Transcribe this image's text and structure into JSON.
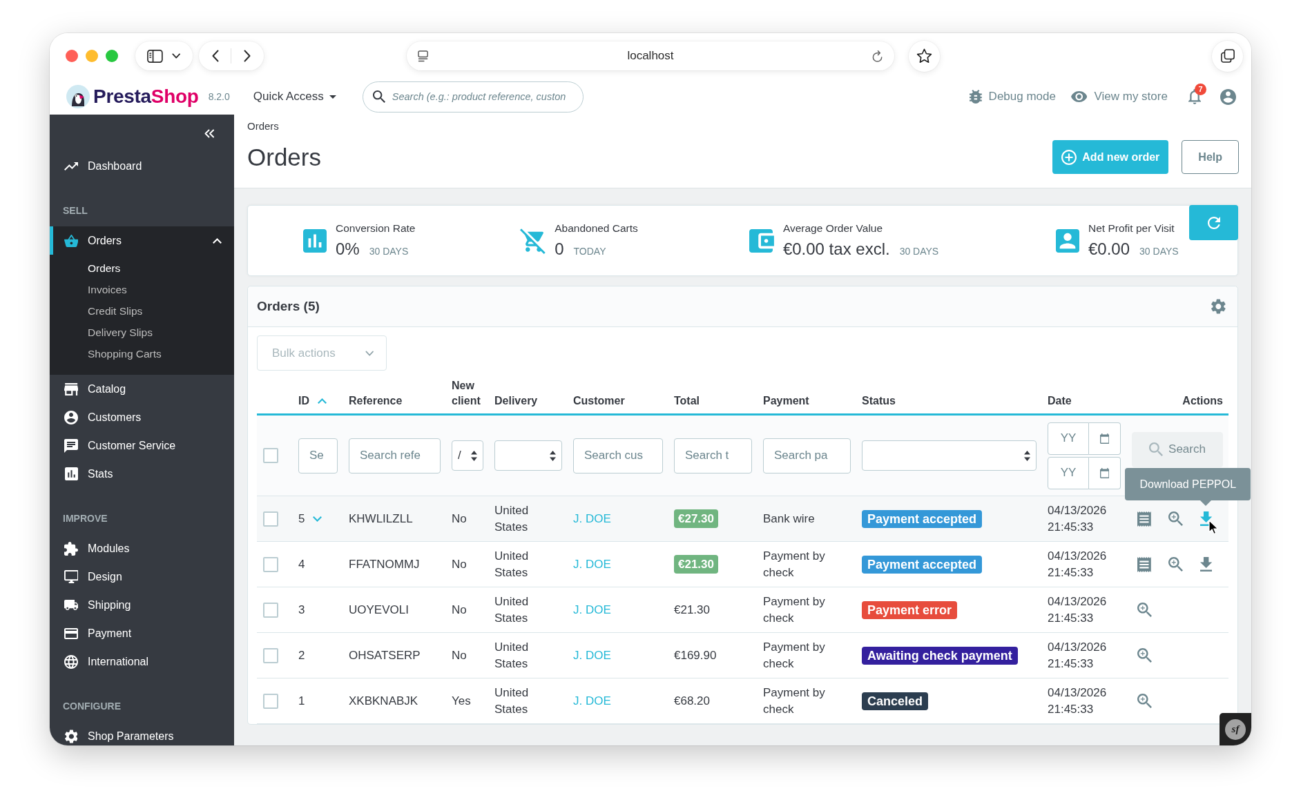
{
  "browser": {
    "url": "localhost"
  },
  "header": {
    "logo": [
      "Presta",
      "Shop"
    ],
    "version": "8.2.0",
    "quick_access": "Quick Access",
    "search": {
      "placeholder": "Search (e.g.: product reference, custon"
    },
    "debug_mode": "Debug mode",
    "view_store": "View my store",
    "notifications": "7"
  },
  "sidebar": {
    "sections": [
      {
        "items": [
          {
            "label": "Dashboard",
            "selected": false
          }
        ]
      },
      {
        "title": "SELL",
        "items": [
          {
            "label": "Orders",
            "selected": true,
            "expanded": true,
            "children": [
              {
                "label": "Orders",
                "selected": true
              },
              {
                "label": "Invoices",
                "selected": false
              },
              {
                "label": "Credit Slips",
                "selected": false
              },
              {
                "label": "Delivery Slips",
                "selected": false
              },
              {
                "label": "Shopping Carts",
                "selected": false
              }
            ]
          },
          {
            "label": "Catalog",
            "selected": false
          },
          {
            "label": "Customers",
            "selected": false
          },
          {
            "label": "Customer Service",
            "selected": false
          },
          {
            "label": "Stats",
            "selected": false
          }
        ]
      },
      {
        "title": "IMPROVE",
        "items": [
          {
            "label": "Modules",
            "selected": false
          },
          {
            "label": "Design",
            "selected": false
          },
          {
            "label": "Shipping",
            "selected": false
          },
          {
            "label": "Payment",
            "selected": false
          },
          {
            "label": "International",
            "selected": false
          }
        ]
      },
      {
        "title": "CONFIGURE",
        "items": [
          {
            "label": "Shop Parameters",
            "selected": false
          }
        ]
      }
    ]
  },
  "page": {
    "breadcrumb": "Orders",
    "title": "Orders",
    "buttons": [
      {
        "kind": "primary",
        "label": "Add new order"
      },
      {
        "kind": "outline",
        "label": "Help"
      }
    ]
  },
  "kpis": [
    {
      "label": "Conversion Rate",
      "value": "0%",
      "period": "30 DAYS"
    },
    {
      "label": "Abandoned Carts",
      "value": "0",
      "period": "TODAY"
    },
    {
      "label": "Average Order Value",
      "value": "€0.00 tax excl.",
      "period": "30 DAYS"
    },
    {
      "label": "Net Profit per Visit",
      "value": "€0.00",
      "period": "30 DAYS"
    }
  ],
  "orders": {
    "title": "Orders (5)",
    "bulk_actions": {
      "label": "Bulk actions",
      "disabled": true
    },
    "columns": [
      {
        "label": "ID",
        "sorted": true
      },
      {
        "label": "Reference",
        "sorted": false
      },
      {
        "label": "New client",
        "sorted": false
      },
      {
        "label": "Delivery",
        "sorted": false
      },
      {
        "label": "Customer",
        "sorted": false
      },
      {
        "label": "Total",
        "sorted": false
      },
      {
        "label": "Payment",
        "sorted": false
      },
      {
        "label": "Status",
        "sorted": false
      },
      {
        "label": "Date",
        "sorted": false
      },
      {
        "label": "Actions",
        "sorted": false
      }
    ],
    "filters": [
      {
        "kind": "checkbox",
        "checked": false
      },
      {
        "kind": "text",
        "placeholder": "Se"
      },
      {
        "kind": "text",
        "placeholder": "Search refe"
      },
      {
        "kind": "select",
        "value": "/"
      },
      {
        "kind": "select"
      },
      {
        "kind": "text",
        "placeholder": "Search cus"
      },
      {
        "kind": "text",
        "placeholder": "Search t"
      },
      {
        "kind": "text",
        "placeholder": "Search pa"
      },
      {
        "kind": "select"
      },
      {
        "kind": "date_range",
        "placeholders": [
          "YY",
          "YY"
        ]
      },
      {
        "kind": "button",
        "label": "Search",
        "disabled": true
      }
    ],
    "rows": [
      {
        "checked": false,
        "hovered": true,
        "id": "5",
        "reference": "KHWLILZLL",
        "new_client": "No",
        "delivery": "United States",
        "customer": "J. DOE",
        "total": {
          "text": "€27.30",
          "highlighted": true
        },
        "payment": "Bank wire",
        "status": {
          "label": "Payment accepted",
          "color": "#3498d8"
        },
        "date": "04/13/2026 21:45:33",
        "actions": [
          {
            "kind": "invoice",
            "hovered": false
          },
          {
            "kind": "view",
            "hovered": false
          },
          {
            "kind": "download",
            "hovered": true,
            "tooltip": "Download PEPPOL"
          }
        ]
      },
      {
        "checked": false,
        "hovered": false,
        "id": "4",
        "reference": "FFATNOMMJ",
        "new_client": "No",
        "delivery": "United States",
        "customer": "J. DOE",
        "total": {
          "text": "€21.30",
          "highlighted": true
        },
        "payment": "Payment by check",
        "status": {
          "label": "Payment accepted",
          "color": "#3498d8"
        },
        "date": "04/13/2026 21:45:33",
        "actions": [
          {
            "kind": "invoice",
            "hovered": false
          },
          {
            "kind": "view",
            "hovered": false
          },
          {
            "kind": "download",
            "hovered": false
          }
        ]
      },
      {
        "checked": false,
        "hovered": false,
        "id": "3",
        "reference": "UOYEVOLI",
        "new_client": "No",
        "delivery": "United States",
        "customer": "J. DOE",
        "total": {
          "text": "€21.30",
          "highlighted": false
        },
        "payment": "Payment by check",
        "status": {
          "label": "Payment error",
          "color": "#e74c3c"
        },
        "date": "04/13/2026 21:45:33",
        "actions": [
          {
            "kind": "view",
            "hovered": false
          }
        ]
      },
      {
        "checked": false,
        "hovered": false,
        "id": "2",
        "reference": "OHSATSERP",
        "new_client": "No",
        "delivery": "United States",
        "customer": "J. DOE",
        "total": {
          "text": "€169.90",
          "highlighted": false
        },
        "payment": "Payment by check",
        "status": {
          "label": "Awaiting check payment",
          "color": "#34209e"
        },
        "date": "04/13/2026 21:45:33",
        "actions": [
          {
            "kind": "view",
            "hovered": false
          }
        ]
      },
      {
        "checked": false,
        "hovered": false,
        "id": "1",
        "reference": "XKBKNABJK",
        "new_client": "Yes",
        "delivery": "United States",
        "customer": "J. DOE",
        "total": {
          "text": "€68.20",
          "highlighted": false
        },
        "payment": "Payment by check",
        "status": {
          "label": "Canceled",
          "color": "#2c3e50"
        },
        "date": "04/13/2026 21:45:33",
        "actions": [
          {
            "kind": "view",
            "hovered": false
          }
        ]
      }
    ]
  },
  "debug_toolbar": {
    "label": "sf"
  }
}
